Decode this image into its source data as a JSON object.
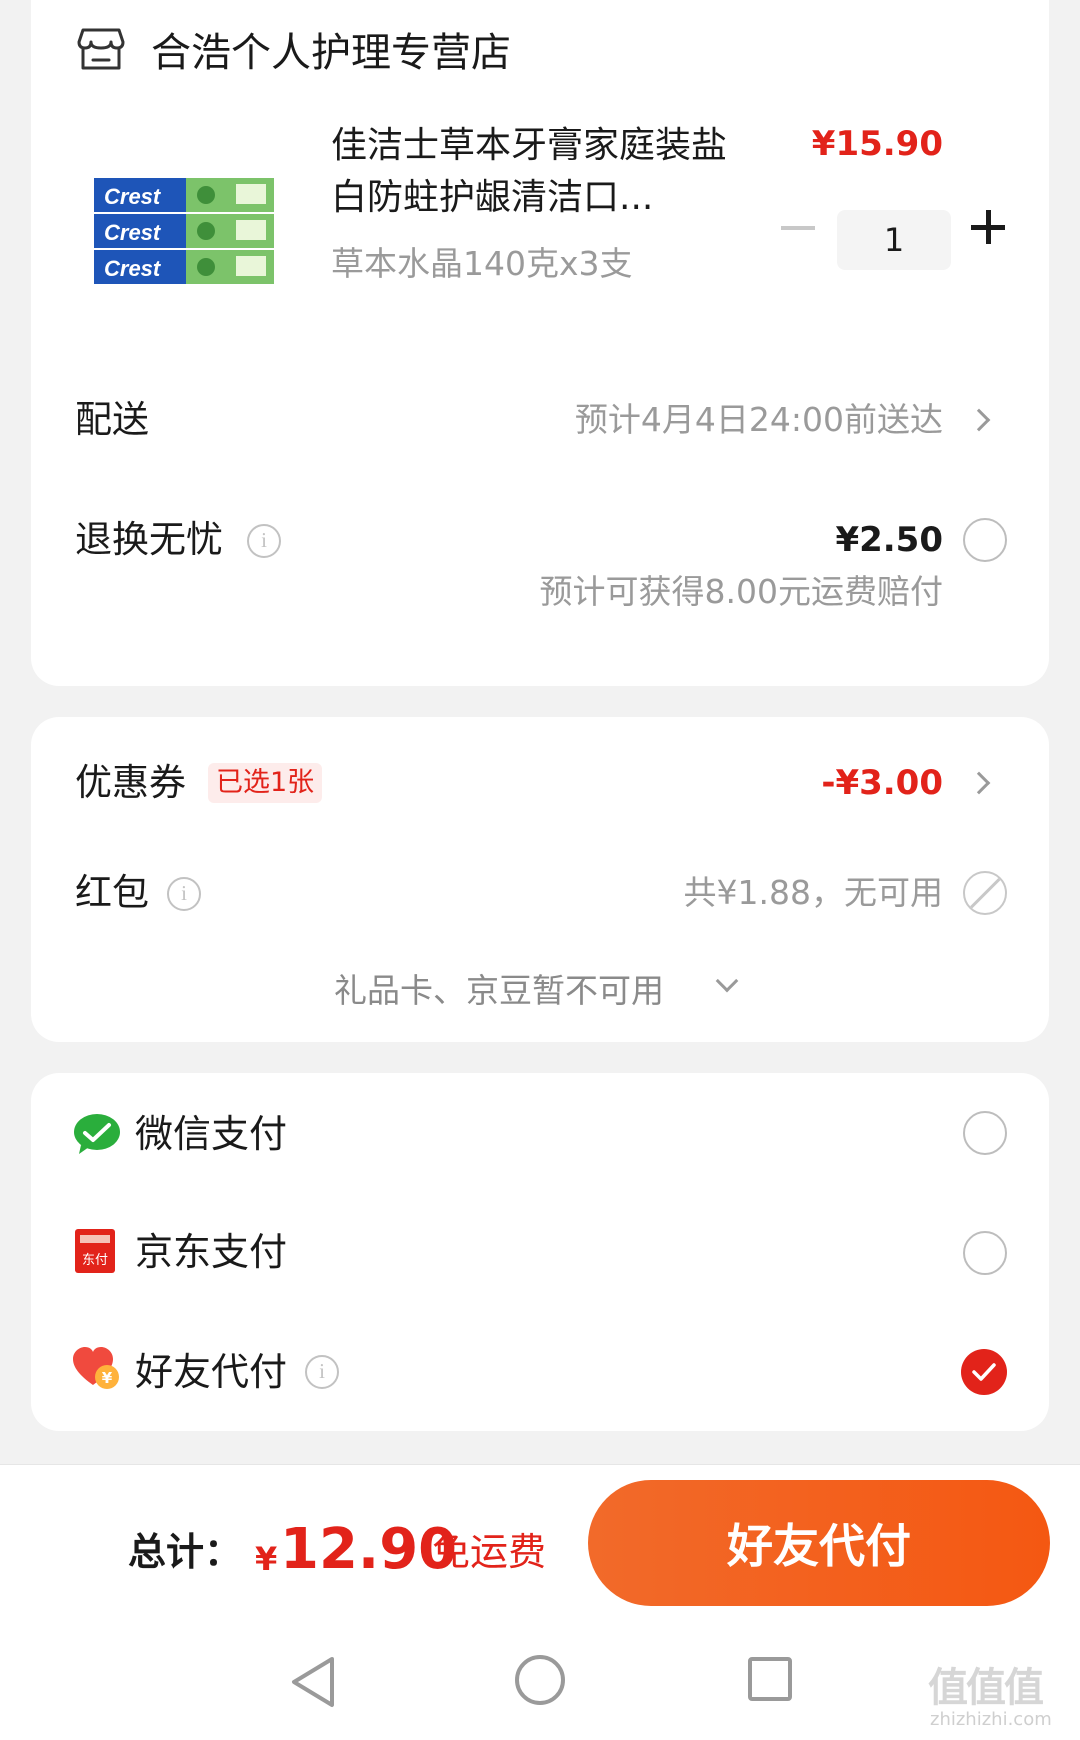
{
  "store": {
    "name": "合浩个人护理专营店",
    "icon": "store-icon"
  },
  "product": {
    "title": "佳洁士草本牙膏家庭装盐白防蛀护龈清洁口...",
    "spec": "草本水晶140克x3支",
    "price": "¥15.90",
    "quantity": "1",
    "image": "crest-toothpaste-3-pack"
  },
  "delivery": {
    "label": "配送",
    "value": "预计4月4日24:00前送达"
  },
  "return_insurance": {
    "label": "退换无忧",
    "price": "¥2.50",
    "note": "预计可获得8.00元运费赔付"
  },
  "coupon": {
    "label": "优惠券",
    "tag": "已选1张",
    "value": "-¥3.00"
  },
  "red_packet": {
    "label": "红包",
    "value": "共¥1.88，无可用"
  },
  "gift_card": {
    "label": "礼品卡、京豆暂不可用"
  },
  "payment_methods": [
    {
      "label": "微信支付",
      "icon": "wechat-pay-icon",
      "selected": false
    },
    {
      "label": "京东支付",
      "icon": "jd-pay-icon",
      "icon_text": "东付",
      "selected": false
    },
    {
      "label": "好友代付",
      "icon": "friend-pay-icon",
      "selected": true
    }
  ],
  "footer": {
    "total_label": "总计：",
    "currency": "¥",
    "total_amount": "12.90",
    "shipping": "免运费",
    "pay_button": "好友代付"
  },
  "watermark": {
    "main": "值值值",
    "sub": "zhizhizhi.com"
  },
  "colors": {
    "accent_red": "#e2231a",
    "button_orange": "#f45812",
    "background": "#f2f2f2"
  }
}
